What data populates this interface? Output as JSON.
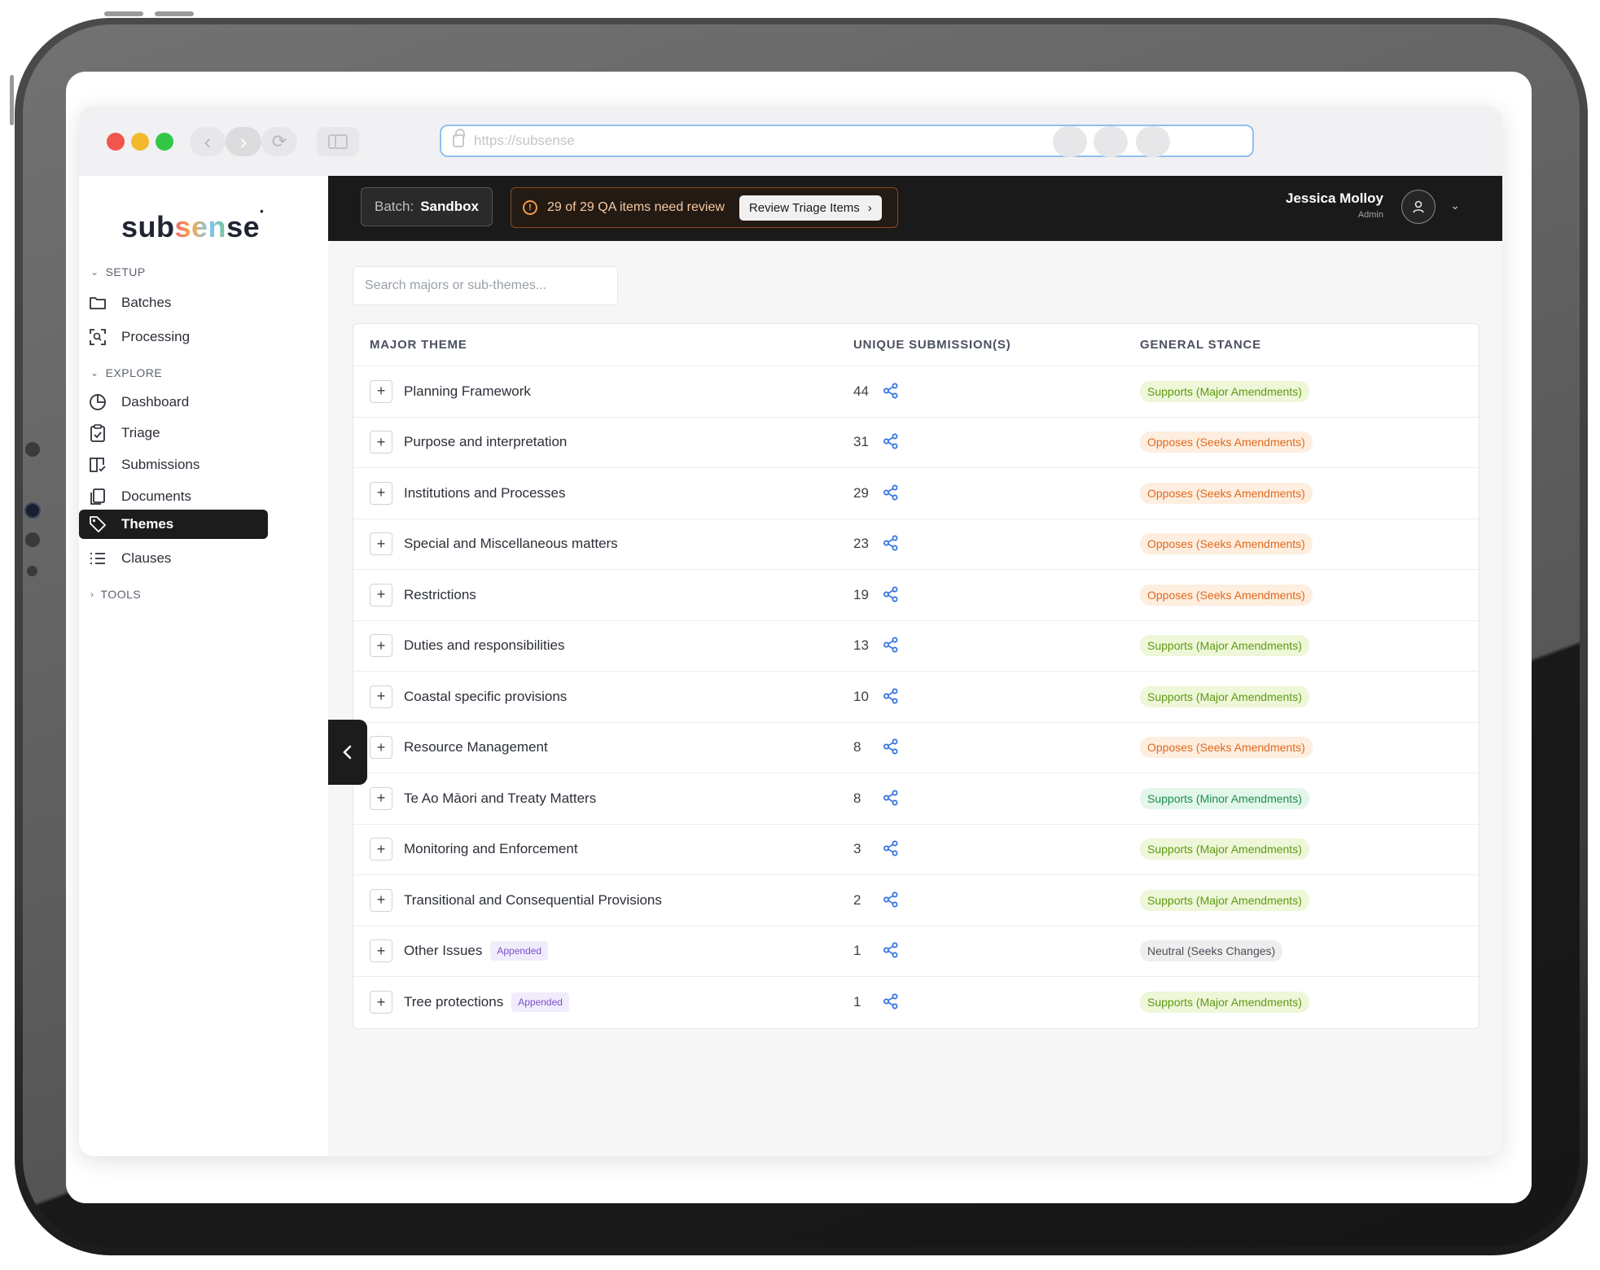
{
  "browser": {
    "url": "https://subsense"
  },
  "app": {
    "logo": {
      "pre": "sub",
      "mid": "sen",
      "post": "se",
      "mark": "•"
    }
  },
  "sidebar": {
    "sections": {
      "setup": "SETUP",
      "explore": "EXPLORE",
      "tools": "TOOLS"
    },
    "items": [
      {
        "label": "Batches",
        "icon": "folder-icon"
      },
      {
        "label": "Processing",
        "icon": "scan-icon"
      },
      {
        "label": "Dashboard",
        "icon": "pie-chart-icon"
      },
      {
        "label": "Triage",
        "icon": "clipboard-check-icon"
      },
      {
        "label": "Submissions",
        "icon": "book-open-icon"
      },
      {
        "label": "Documents",
        "icon": "documents-icon"
      },
      {
        "label": "Themes",
        "icon": "tag-icon",
        "active": true
      },
      {
        "label": "Clauses",
        "icon": "list-icon"
      }
    ]
  },
  "topbar": {
    "batch_label": "Batch:",
    "batch_name": "Sandbox",
    "alert_text": "29 of 29 QA items need review",
    "review_button": "Review Triage Items",
    "user_name": "Jessica Molloy",
    "user_role": "Admin"
  },
  "search": {
    "placeholder": "Search majors or sub-themes..."
  },
  "table": {
    "headers": {
      "major_theme": "MAJOR THEME",
      "unique_submissions": "UNIQUE SUBMISSION(S)",
      "general_stance": "GENERAL STANCE"
    },
    "rows": [
      {
        "theme": "Planning Framework",
        "count": "44",
        "stance": "Supports (Major Amendments)",
        "stance_type": "green"
      },
      {
        "theme": "Purpose and interpretation",
        "count": "31",
        "stance": "Opposes (Seeks Amendments)",
        "stance_type": "orange"
      },
      {
        "theme": "Institutions and Processes",
        "count": "29",
        "stance": "Opposes (Seeks Amendments)",
        "stance_type": "orange"
      },
      {
        "theme": "Special and Miscellaneous matters",
        "count": "23",
        "stance": "Opposes (Seeks Amendments)",
        "stance_type": "orange"
      },
      {
        "theme": "Restrictions",
        "count": "19",
        "stance": "Opposes (Seeks Amendments)",
        "stance_type": "orange"
      },
      {
        "theme": "Duties and responsibilities",
        "count": "13",
        "stance": "Supports (Major Amendments)",
        "stance_type": "green"
      },
      {
        "theme": "Coastal specific provisions",
        "count": "10",
        "stance": "Supports (Major Amendments)",
        "stance_type": "green"
      },
      {
        "theme": "Resource Management",
        "count": "8",
        "stance": "Opposes (Seeks Amendments)",
        "stance_type": "orange"
      },
      {
        "theme": "Te Ao Māori and Treaty Matters",
        "count": "8",
        "stance": "Supports (Minor Amendments)",
        "stance_type": "teal"
      },
      {
        "theme": "Monitoring and Enforcement",
        "count": "3",
        "stance": "Supports (Major Amendments)",
        "stance_type": "green"
      },
      {
        "theme": "Transitional and Consequential Provisions",
        "count": "2",
        "stance": "Supports (Major Amendments)",
        "stance_type": "green"
      },
      {
        "theme": "Other Issues",
        "count": "1",
        "badge": "Appended",
        "stance": "Neutral (Seeks Changes)",
        "stance_type": "gray"
      },
      {
        "theme": "Tree protections",
        "count": "1",
        "badge": "Appended",
        "stance": "Supports (Major Amendments)",
        "stance_type": "green"
      }
    ]
  },
  "colors": {
    "green": "#5e9a12",
    "orange": "#e06a1e",
    "teal": "#1d8f4e",
    "gray": "#4b4f57",
    "share": "#2f6fe0"
  }
}
